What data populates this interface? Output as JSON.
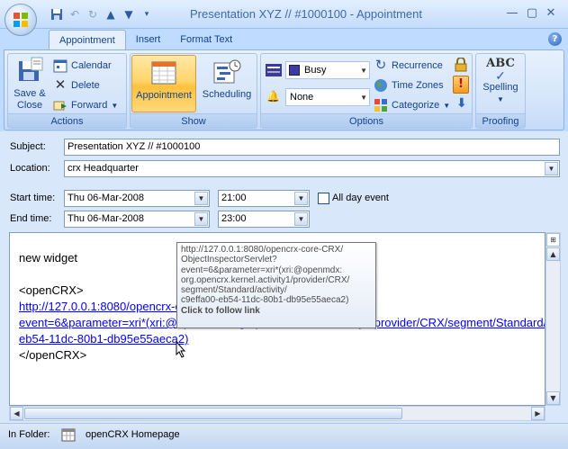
{
  "window": {
    "title": "Presentation XYZ // #1000100 - Appointment"
  },
  "ribbon": {
    "tabs": [
      "Appointment",
      "Insert",
      "Format Text"
    ],
    "actions": {
      "label": "Actions",
      "save_close": [
        "Save &",
        "Close"
      ],
      "calendar": "Calendar",
      "delete": "Delete",
      "forward": "Forward"
    },
    "show": {
      "label": "Show",
      "appointment": "Appointment",
      "scheduling": "Scheduling"
    },
    "options": {
      "label": "Options",
      "show_as": "Busy",
      "reminder": "None",
      "recurrence": "Recurrence",
      "time_zones": "Time Zones",
      "categorize": "Categorize"
    },
    "proofing": {
      "label": "Proofing",
      "spelling": "Spelling",
      "abc": "ABC"
    }
  },
  "form": {
    "subject_label": "Subject:",
    "subject_value": "Presentation XYZ // #1000100",
    "location_label": "Location:",
    "location_value": "crx Headquarter",
    "start_label": "Start time:",
    "start_date": "Thu 06-Mar-2008",
    "start_time": "21:00",
    "allday_label": "All day event",
    "end_label": "End time:",
    "end_date": "Thu 06-Mar-2008",
    "end_time": "23:00"
  },
  "body": {
    "line1": "new widget",
    "open_tag": "<openCRX>",
    "link_part1": "http://127.0.0.1:8080/opencrx-core-CRX/ObjectInspectorServlet?",
    "link_part2": "event=6&parameter=xri*(xri:@openmdx:org.opencrx.kernel.activity1/provider/CRX/segment/Standard/activity/c9effa00-",
    "link_part3": "eb54-11dc-80b1-db95e55aeca2)",
    "close_tag": "</openCRX>"
  },
  "tooltip": {
    "lines": [
      "http://127.0.0.1:8080/opencrx-core-CRX/",
      "ObjectInspectorServlet?",
      "event=6&parameter=xri*(xri:@openmdx:",
      "org.opencrx.kernel.activity1/provider/CRX/",
      "segment/Standard/activity/",
      "c9effa00-eb54-11dc-80b1-db95e55aeca2)"
    ],
    "action": "Click to follow link"
  },
  "status": {
    "in_folder_label": "In Folder:",
    "folder_name": "openCRX Homepage"
  },
  "colors": {
    "ribbon_blue": "#15428b",
    "active_orange": "#ffc13d",
    "link_blue": "#0000ff"
  }
}
